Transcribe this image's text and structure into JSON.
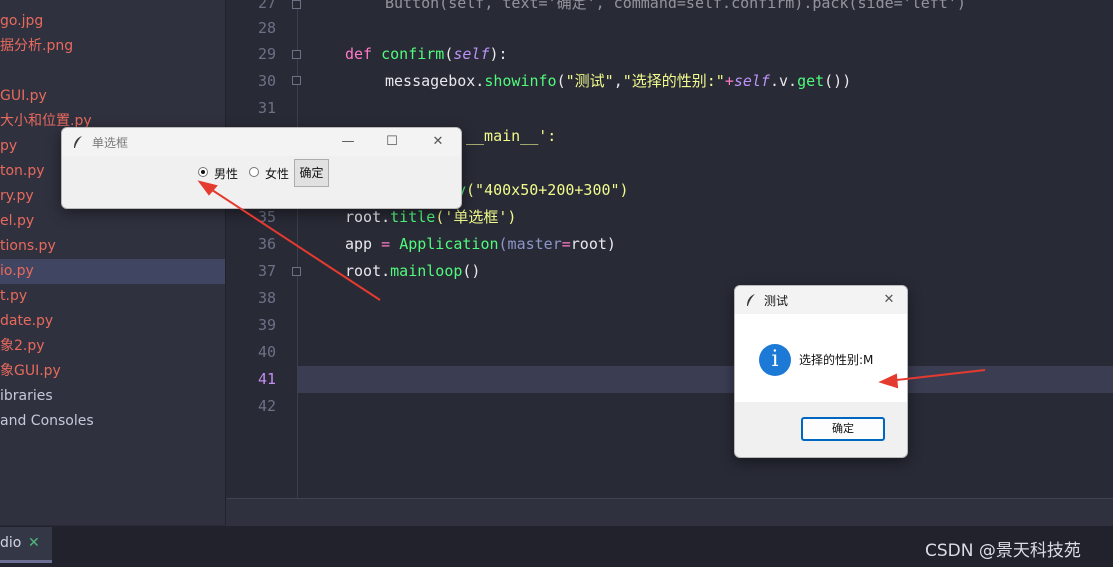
{
  "sidebar": {
    "files": [
      {
        "label": "go.jpg",
        "style": "red"
      },
      {
        "label": "据分析.png",
        "style": "red"
      },
      {
        "label": "GUI.py",
        "style": "red"
      },
      {
        "label": "大小和位置.py",
        "style": "red"
      },
      {
        "label": "py",
        "style": "red"
      },
      {
        "label": "ton.py",
        "style": "red"
      },
      {
        "label": "ry.py",
        "style": "red"
      },
      {
        "label": "el.py",
        "style": "red"
      },
      {
        "label": "tions.py",
        "style": "red"
      },
      {
        "label": "io.py",
        "style": "red"
      },
      {
        "label": "t.py",
        "style": "red"
      },
      {
        "label": "date.py",
        "style": "red"
      },
      {
        "label": "象2.py",
        "style": "red"
      },
      {
        "label": "象GUI.py",
        "style": "red"
      },
      {
        "label": "ibraries",
        "style": "grey"
      },
      {
        "label": "and Consoles",
        "style": "grey"
      }
    ]
  },
  "editor": {
    "line_numbers": [
      "27",
      "28",
      "29",
      "30",
      "31",
      "32",
      "33",
      "34",
      "35",
      "36",
      "37",
      "38",
      "39",
      "40",
      "41",
      "42"
    ],
    "current_line": "41",
    "code": {
      "l27": "Button(self, text='确定', command=self.confirm).pack(side='left')",
      "l29_kw": "def ",
      "l29_fn": "confirm",
      "l29_open": "(",
      "l29_self": "self",
      "l29_close": "):",
      "l30_pre": "messagebox.",
      "l30_fn": "showinfo",
      "l30_open": "(",
      "l30_s1": "\"测试\"",
      "l30_comma": ",",
      "l30_s2": "\"选择的性别:\"",
      "l30_plus": "+",
      "l30_self": "self",
      "l30_dotv": ".v.",
      "l30_get": "get",
      "l30_end": "())",
      "l32_tail": "__main__':",
      "l34_fn": "y",
      "l34_str": "(\"400x50+200+300\")",
      "l35_pre": "root.",
      "l35_fn": "title",
      "l35_str": "('单选框')",
      "l36_a": "app ",
      "l36_eq": "= ",
      "l36_fn": "Application",
      "l36_param": "(master",
      "l36_eq2": "=",
      "l36_end": "root)",
      "l37_pre": "root.",
      "l37_fn": "mainloop",
      "l37_end": "()"
    }
  },
  "radio_window": {
    "title": "单选框",
    "minimize": "—",
    "maximize": "☐",
    "close": "✕",
    "option_male": "男性",
    "option_female": "女性",
    "selected": "男性",
    "confirm_label": "确定"
  },
  "message_box": {
    "title": "测试",
    "close": "✕",
    "icon": "info-icon",
    "message": "选择的性别:M",
    "ok_label": "确定"
  },
  "bottom": {
    "run_tab": "dio",
    "run_tab_close": "✕",
    "watermark": "CSDN @景天科技苑"
  },
  "colors": {
    "arrow": "#e53a2f",
    "keyword": "#ff79c6",
    "function": "#50fa7b",
    "string": "#f1fa8c",
    "self": "#bd93f9",
    "file_error": "#e86a5c"
  }
}
